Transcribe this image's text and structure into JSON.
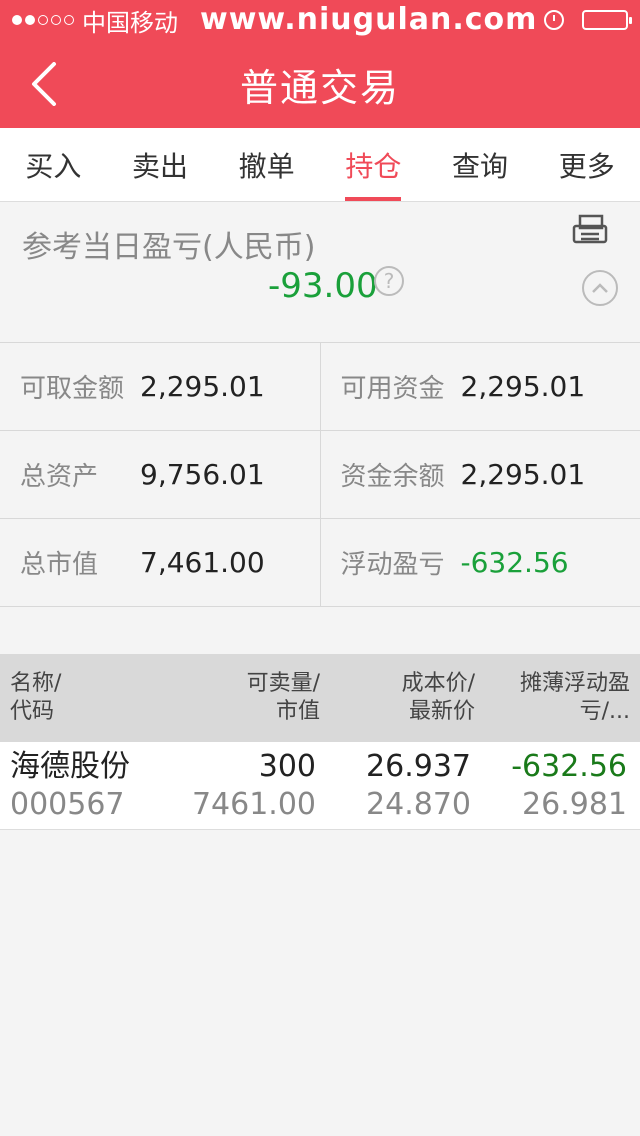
{
  "status_bar": {
    "carrier": "中国移动",
    "watermark": "www.niugulan.com"
  },
  "nav": {
    "title": "普通交易"
  },
  "tabs": [
    {
      "label": "买入"
    },
    {
      "label": "卖出"
    },
    {
      "label": "撤单"
    },
    {
      "label": "持仓",
      "active": true
    },
    {
      "label": "查询"
    },
    {
      "label": "更多"
    }
  ],
  "daily_pnl": {
    "label": "参考当日盈亏(人民币)",
    "value": "-93.00",
    "help": "?"
  },
  "account": {
    "withdrawable": {
      "label": "可取金额",
      "value": "2,295.01"
    },
    "available": {
      "label": "可用资金",
      "value": "2,295.01"
    },
    "total_assets": {
      "label": "总资产",
      "value": "9,756.01"
    },
    "balance": {
      "label": "资金余额",
      "value": "2,295.01"
    },
    "market_value": {
      "label": "总市值",
      "value": "7,461.00"
    },
    "floating_pnl": {
      "label": "浮动盈亏",
      "value": "-632.56"
    }
  },
  "holdings": {
    "headers": [
      {
        "line1": "名称/",
        "line2": "代码"
      },
      {
        "line1": "可卖量/",
        "line2": "市值"
      },
      {
        "line1": "成本价/",
        "line2": "最新价"
      },
      {
        "line1": "摊薄浮动盈",
        "line2": "亏/..."
      }
    ],
    "rows": [
      {
        "name": "海德股份",
        "code": "000567",
        "sellable": "300",
        "market_value": "7461.00",
        "cost": "26.937",
        "latest": "24.870",
        "floating_pnl": "-632.56",
        "diluted": "26.981"
      }
    ]
  },
  "colors": {
    "brand": "#f04a58",
    "profit_negative": "#1aa03a"
  }
}
